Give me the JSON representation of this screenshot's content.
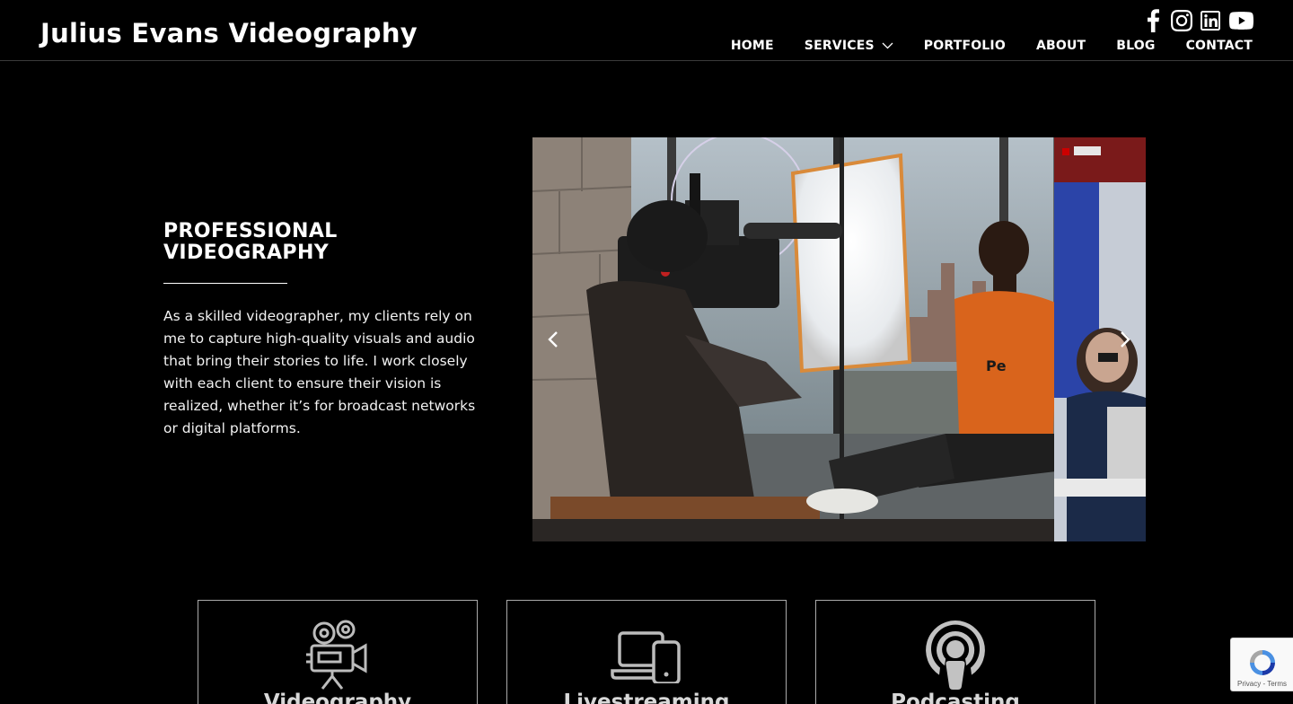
{
  "site": {
    "title": "Julius Evans Videography"
  },
  "social": [
    {
      "icon": "facebook-icon"
    },
    {
      "icon": "instagram-icon"
    },
    {
      "icon": "linkedin-icon"
    },
    {
      "icon": "youtube-icon"
    }
  ],
  "nav": {
    "home": "HOME",
    "services": "SERVICES",
    "portfolio": "PORTFOLIO",
    "about": "ABOUT",
    "blog": "BLOG",
    "contact": "CONTACT"
  },
  "intro": {
    "heading_line1": "PROFESSIONAL",
    "heading_line2": "VIDEOGRAPHY",
    "body": "As a skilled videographer, my clients rely on me to capture high-quality visuals and audio that bring their stories to life. I work closely with each client to ensure their vision is realized, whether it’s for broadcast networks or digital platforms."
  },
  "slider": {
    "prev_icon": "chevron-left-icon",
    "next_icon": "chevron-right-icon",
    "partial_slide_logo": "redhat"
  },
  "services": [
    {
      "label": "Videography",
      "icon": "film-camera-icon"
    },
    {
      "label": "Livestreaming",
      "icon": "laptop-phone-icon"
    },
    {
      "label": "Podcasting",
      "icon": "podcast-icon"
    }
  ],
  "recaptcha": {
    "text": "Privacy - Terms"
  },
  "colors": {
    "background": "#000000",
    "text": "#ffffff",
    "card_border": "#aaaaaa",
    "orange_shirt": "#d9641c"
  }
}
